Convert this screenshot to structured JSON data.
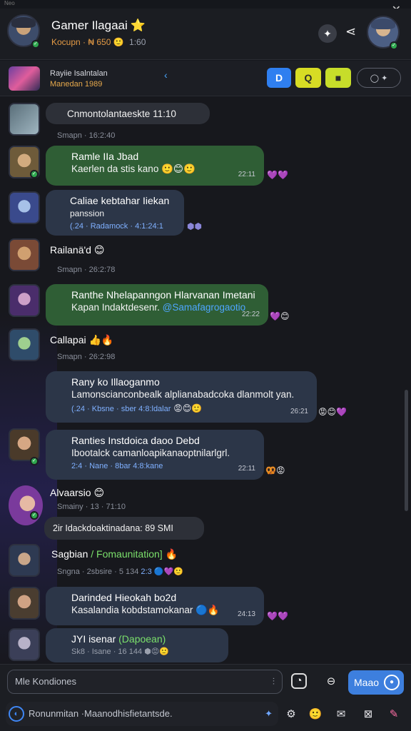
{
  "window": {
    "label": "Neo",
    "close_icon": "close-icon"
  },
  "header": {
    "title": "Gamer Ilagaai",
    "title_emoji": "⭐",
    "subtitle": "Kocupn · ₦ 650",
    "subtitle_emoji": "🙂",
    "subtitle_time": "1:60"
  },
  "subbar": {
    "line1": "Rayiie Isalntalan",
    "line2": "Manedan 1989",
    "tool1": "D",
    "tool2": "Q",
    "tool3": "■",
    "tool4": "◯ ✦"
  },
  "messages": [
    {
      "bubble": "Cnmontolantaeskte 11:10",
      "meta": "Smapn  ·  16:2:40"
    },
    {
      "name": "Ramle IIa Jbad",
      "text": "Kaerlen da stis kano",
      "emojis": "🙂😊🙂",
      "time": "22:11",
      "reacts": "💜💜"
    },
    {
      "name": "Caliae kebtahar Iiekan",
      "text": "panssion",
      "meta_line": "(.24 · Radamock · 4:1:24:1",
      "reacts": "⬢⬢"
    },
    {
      "plain": "Railanä'd",
      "plain_emoji": "😊",
      "meta": "Smapn  ·  26:2:78"
    },
    {
      "name": "Ranthe Nhelapanngon Hlarvanan Imetani",
      "text": "Kapan Indaktdesenr.",
      "link": "@Samafagrogaotio",
      "time": "22:22",
      "reacts": "💜😊"
    },
    {
      "plain": "Callapai",
      "plain_emoji": "👍🔥",
      "meta": "Smapn  ·  26:2:98"
    },
    {
      "name": "Rany ko Illaoganmo",
      "text": "Lamonscianconbealk alplianabadcoka dlanmolt yan.",
      "meta_line": "(.24 · Kbsne · sber 4:8:ldalar",
      "emojis": "😡😊🙂",
      "time": "26:21",
      "reacts": "😡😊💜"
    },
    {
      "name": "Ranties Instdoica daoo Debd",
      "name_accent": "Instdoica",
      "text": "Ibootalck camanloapikanaoptnilarlgrl.",
      "meta_line": "2:4 · Nane · 8bar 4:8:kane",
      "time": "22:11",
      "reacts": "🥨😡"
    },
    {
      "plain": "Alvaarsio",
      "plain_emoji": "😊",
      "meta": "Smainy  ·  13 · 71:10"
    },
    {
      "bubble": "2ir Idackdoaktinadana: 89 SMI"
    },
    {
      "plain": "Sagbian",
      "plain_accent": "/ Fomaunitation]",
      "plain_emoji": "🔥",
      "meta": "Sngna  ·  2sbsire · 5 134",
      "meta_emojis": "2:3 🔵💜🙂"
    },
    {
      "name": "Darinded Hieokah bo2d",
      "text": "Kasalandia kobdstamokanar",
      "emojis": "🔵🔥",
      "time": "24:13",
      "reacts": "💜💜"
    },
    {
      "plain": "JYI isenar",
      "plain_accent": "(Dapoean)",
      "meta": "Sk8 · Isane · 16 144",
      "meta_emojis": "⬢😡🙂"
    }
  ],
  "composer": {
    "placeholder": "Mle Kondiones",
    "send_label": "Maao",
    "second_placeholder": "Ronunmitan  ·Maanodhisfietantsde."
  },
  "colors": {
    "accent": "#3d7fde",
    "green_bubble": "#2f5e35",
    "blue_bubble": "#2c3648",
    "gray_bubble": "#2d3038",
    "link": "#4ea6ff"
  }
}
